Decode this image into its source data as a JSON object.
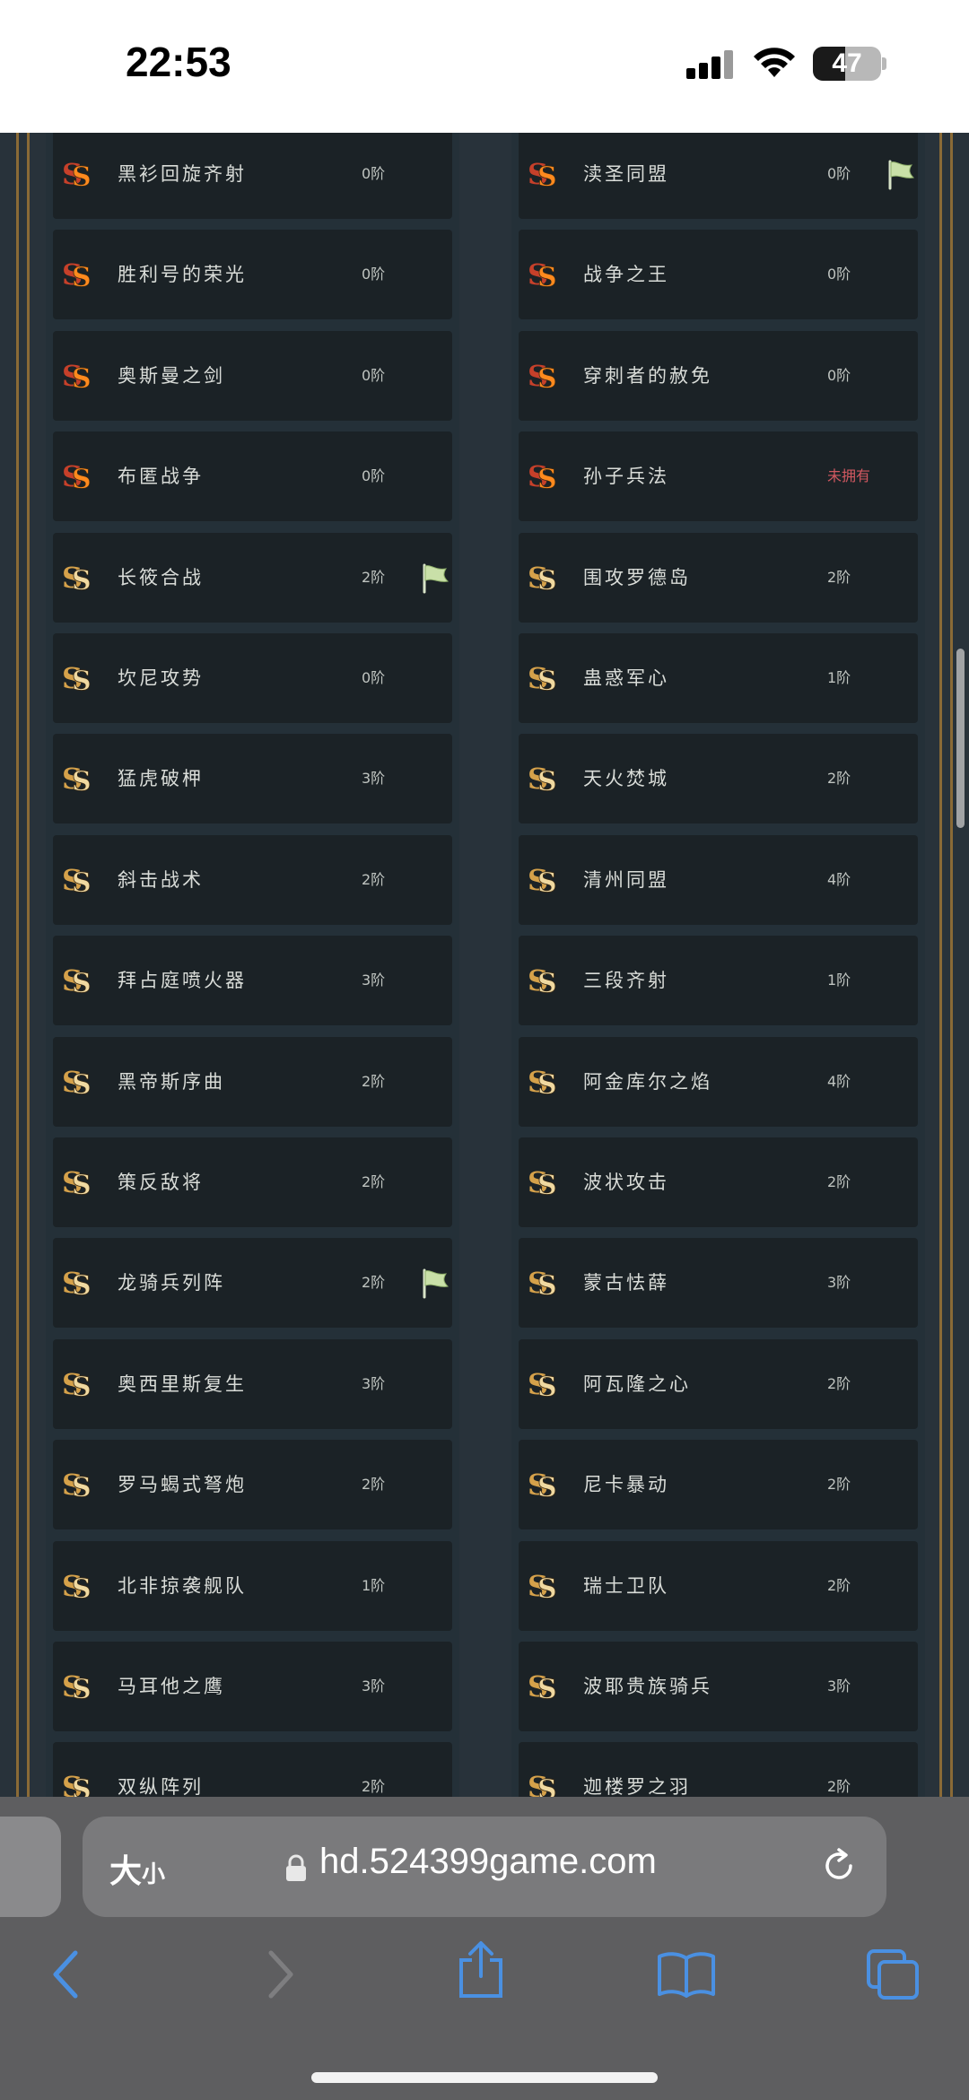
{
  "status_bar": {
    "time": "22:53",
    "battery_level": "47",
    "battery_fill_percent": 47
  },
  "colors": {
    "card_bg": "#1b2226",
    "text": "#d9dcd8",
    "missing_text": "#d05860",
    "gold_rail": "#8a6a36",
    "browser_bg": "#5e5e60"
  },
  "left_cards": [
    {
      "name": "黑衫回旋齐射",
      "level": "0阶",
      "badge": "orange-s",
      "flag": false
    },
    {
      "name": "胜利号的荣光",
      "level": "0阶",
      "badge": "orange-s",
      "flag": false
    },
    {
      "name": "奥斯曼之剑",
      "level": "0阶",
      "badge": "orange-s",
      "flag": false
    },
    {
      "name": "布匿战争",
      "level": "0阶",
      "badge": "orange-s",
      "flag": false
    },
    {
      "name": "长筱合战",
      "level": "2阶",
      "badge": "gold-s",
      "flag": true
    },
    {
      "name": "坎尼攻势",
      "level": "0阶",
      "badge": "gold-s",
      "flag": false
    },
    {
      "name": "猛虎破柙",
      "level": "3阶",
      "badge": "gold-s",
      "flag": false
    },
    {
      "name": "斜击战术",
      "level": "2阶",
      "badge": "gold-s",
      "flag": false
    },
    {
      "name": "拜占庭喷火器",
      "level": "3阶",
      "badge": "gold-s",
      "flag": false
    },
    {
      "name": "黑帝斯序曲",
      "level": "2阶",
      "badge": "gold-s",
      "flag": false
    },
    {
      "name": "策反敌将",
      "level": "2阶",
      "badge": "gold-s",
      "flag": false
    },
    {
      "name": "龙骑兵列阵",
      "level": "2阶",
      "badge": "gold-s",
      "flag": true
    },
    {
      "name": "奥西里斯复生",
      "level": "3阶",
      "badge": "gold-s",
      "flag": false
    },
    {
      "name": "罗马蝎式弩炮",
      "level": "2阶",
      "badge": "gold-s",
      "flag": false
    },
    {
      "name": "北非掠袭舰队",
      "level": "1阶",
      "badge": "gold-s",
      "flag": false
    },
    {
      "name": "马耳他之鹰",
      "level": "3阶",
      "badge": "gold-s",
      "flag": false
    },
    {
      "name": "双纵阵列",
      "level": "2阶",
      "badge": "gold-s",
      "flag": false
    }
  ],
  "right_cards": [
    {
      "name": "渎圣同盟",
      "level": "0阶",
      "badge": "orange-s",
      "flag": true
    },
    {
      "name": "战争之王",
      "level": "0阶",
      "badge": "orange-s",
      "flag": false
    },
    {
      "name": "穿刺者的赦免",
      "level": "0阶",
      "badge": "orange-s",
      "flag": false
    },
    {
      "name": "孙子兵法",
      "level": "未拥有",
      "badge": "orange-s",
      "flag": false,
      "missing": true
    },
    {
      "name": "围攻罗德岛",
      "level": "2阶",
      "badge": "gold-s",
      "flag": false
    },
    {
      "name": "蛊惑军心",
      "level": "1阶",
      "badge": "gold-s",
      "flag": false
    },
    {
      "name": "天火焚城",
      "level": "2阶",
      "badge": "gold-s",
      "flag": false
    },
    {
      "name": "清州同盟",
      "level": "4阶",
      "badge": "gold-s",
      "flag": false
    },
    {
      "name": "三段齐射",
      "level": "1阶",
      "badge": "gold-s",
      "flag": false
    },
    {
      "name": "阿金库尔之焰",
      "level": "4阶",
      "badge": "gold-s",
      "flag": false
    },
    {
      "name": "波状攻击",
      "level": "2阶",
      "badge": "gold-s",
      "flag": false
    },
    {
      "name": "蒙古怯薛",
      "level": "3阶",
      "badge": "gold-s",
      "flag": false
    },
    {
      "name": "阿瓦隆之心",
      "level": "2阶",
      "badge": "gold-s",
      "flag": false
    },
    {
      "name": "尼卡暴动",
      "level": "2阶",
      "badge": "gold-s",
      "flag": false
    },
    {
      "name": "瑞士卫队",
      "level": "2阶",
      "badge": "gold-s",
      "flag": false
    },
    {
      "name": "波耶贵族骑兵",
      "level": "3阶",
      "badge": "gold-s",
      "flag": false
    },
    {
      "name": "迦楼罗之羽",
      "level": "2阶",
      "badge": "gold-s",
      "flag": false
    }
  ],
  "browser": {
    "text_size_label": "大",
    "text_size_label_small": "小",
    "url": "hd.524399game.com",
    "toolbar_icons": [
      "back-icon",
      "forward-icon",
      "share-icon",
      "bookmarks-icon",
      "tabs-icon"
    ]
  }
}
